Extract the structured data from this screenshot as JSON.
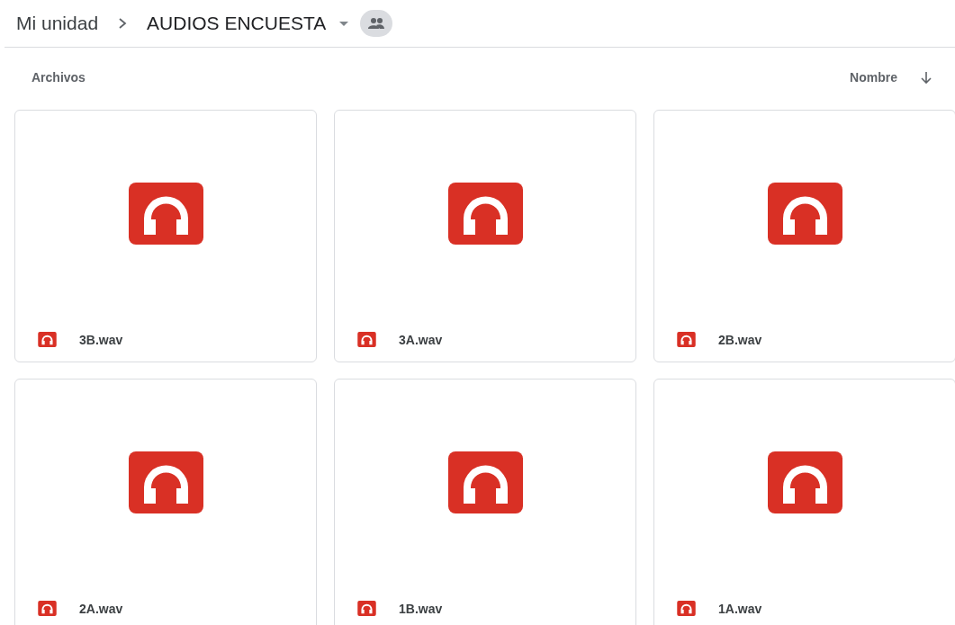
{
  "breadcrumb": [
    {
      "label": "Mi unidad"
    },
    {
      "label": "AUDIOS ENCUESTA"
    }
  ],
  "section_title": "Archivos",
  "sort": {
    "label": "Nombre"
  },
  "files": [
    {
      "name": "3B.wav",
      "kind": "audio"
    },
    {
      "name": "3A.wav",
      "kind": "audio"
    },
    {
      "name": "2B.wav",
      "kind": "audio"
    },
    {
      "name": "2A.wav",
      "kind": "audio"
    },
    {
      "name": "1B.wav",
      "kind": "audio"
    },
    {
      "name": "1A.wav",
      "kind": "audio"
    }
  ]
}
